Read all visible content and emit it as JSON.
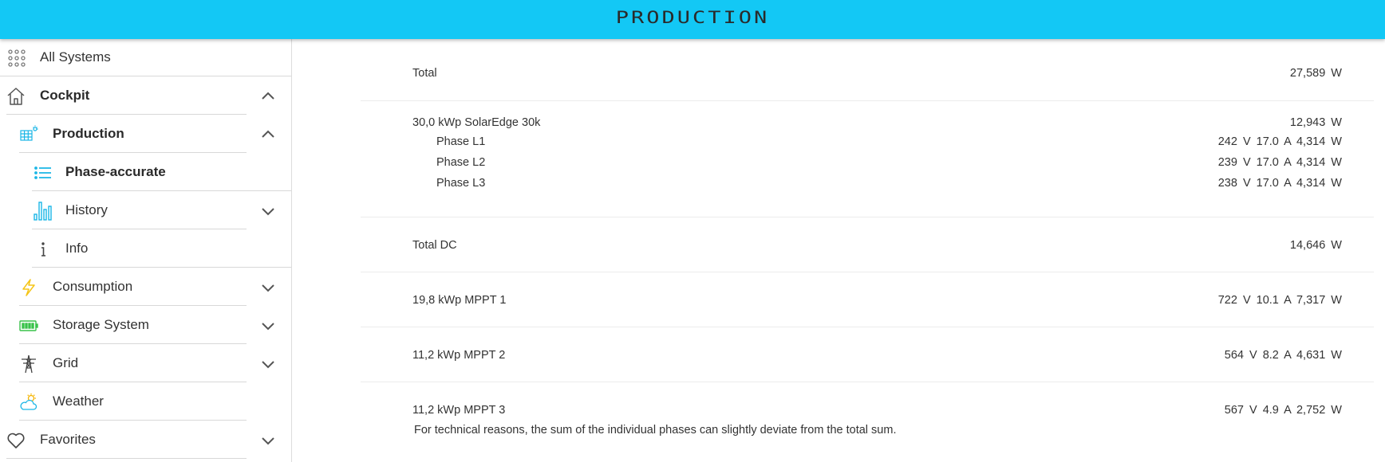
{
  "header": {
    "title": "PRODUCTION"
  },
  "sidebar": {
    "all_systems": "All Systems",
    "cockpit": "Cockpit",
    "production": "Production",
    "phase_accurate": "Phase-accurate",
    "history": "History",
    "info": "Info",
    "consumption": "Consumption",
    "storage": "Storage System",
    "grid": "Grid",
    "weather": "Weather",
    "favorites": "Favorites"
  },
  "production": {
    "total_label": "Total",
    "total_value": "27,589 W",
    "inverter_label": "30,0 kWp SolarEdge 30k",
    "inverter_value": "12,943 W",
    "phases": [
      {
        "label": "Phase L1",
        "value": "242 V  17.0 A  4,314 W"
      },
      {
        "label": "Phase L2",
        "value": "239 V  17.0 A  4,314 W"
      },
      {
        "label": "Phase L3",
        "value": "238 V  17.0 A  4,314 W"
      }
    ],
    "total_dc_label": "Total DC",
    "total_dc_value": "14,646 W",
    "mppts": [
      {
        "label": "19,8 kWp MPPT 1",
        "value": "722 V  10.1 A  7,317 W"
      },
      {
        "label": "11,2 kWp MPPT 2",
        "value": "564 V  8.2 A  4,631 W"
      },
      {
        "label": "11,2 kWp MPPT 3",
        "value": "567 V  4.9 A  2,752 W"
      }
    ],
    "note": "For technical reasons, the sum of the individual phases can slightly deviate from the total sum."
  },
  "colors": {
    "header": "#13c8f5",
    "accent": "#1ab6e6",
    "consumption": "#f5c518",
    "storage": "#39c24a"
  },
  "icons": [
    "grid-icon",
    "home-icon",
    "solar-panel-icon",
    "list-icon",
    "bar-chart-icon",
    "info-icon",
    "lightning-icon",
    "battery-icon",
    "power-tower-icon",
    "cloud-sun-icon",
    "heart-icon",
    "chevron-up-icon",
    "chevron-down-icon"
  ]
}
